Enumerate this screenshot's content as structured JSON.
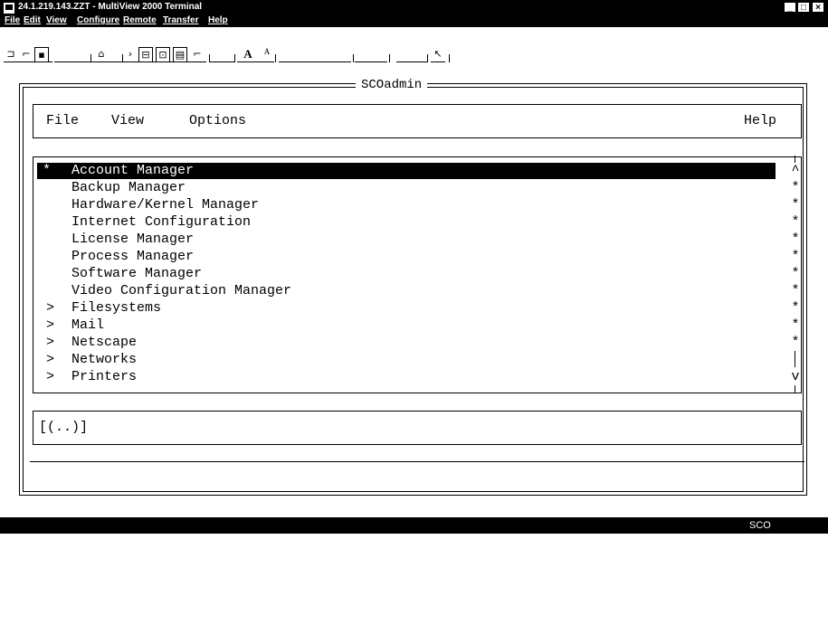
{
  "window": {
    "title": "24.1.219.143.ZZT - MultiView 2000 Terminal",
    "controls": [
      "_",
      "□",
      "×"
    ]
  },
  "menu": [
    "File",
    "Edit",
    "View",
    "Configure",
    "Remote",
    "Transfer",
    "Help"
  ],
  "toolbar": [
    "new-session-icon",
    "open-icon",
    "save-icon",
    "copy-icon",
    "send-icon",
    "print-icon",
    "capture-icon",
    "keyboard-icon",
    "macro-icon",
    "font-large-icon",
    "font-small-icon",
    "pointer-icon"
  ],
  "toolbar_text": {
    "font_large": "A",
    "font_small": "A"
  },
  "terminal": {
    "caption": "SCOadmin",
    "menu": {
      "file": "File",
      "view": "View",
      "options": "Options",
      "help": "Help"
    },
    "items": [
      {
        "marker": "*",
        "label": "Account Manager",
        "selected": true
      },
      {
        "marker": " ",
        "label": "Backup Manager"
      },
      {
        "marker": " ",
        "label": "Hardware/Kernel Manager"
      },
      {
        "marker": " ",
        "label": "Internet Configuration"
      },
      {
        "marker": " ",
        "label": "License Manager"
      },
      {
        "marker": " ",
        "label": "Process Manager"
      },
      {
        "marker": " ",
        "label": "Software Manager"
      },
      {
        "marker": " ",
        "label": "Video Configuration Manager"
      },
      {
        "marker": ">",
        "label": "Filesystems"
      },
      {
        "marker": ">",
        "label": "Mail"
      },
      {
        "marker": ">",
        "label": "Netscape"
      },
      {
        "marker": ">",
        "label": "Networks"
      },
      {
        "marker": ">",
        "label": "Printers"
      }
    ],
    "scroll": {
      "up": "^",
      "down": "v",
      "marks": [
        "*",
        "*",
        "*",
        "*",
        "*",
        "*",
        "*",
        "*",
        "*",
        "*"
      ]
    },
    "input": "[(..)]"
  },
  "status": {
    "text": "SCO"
  }
}
